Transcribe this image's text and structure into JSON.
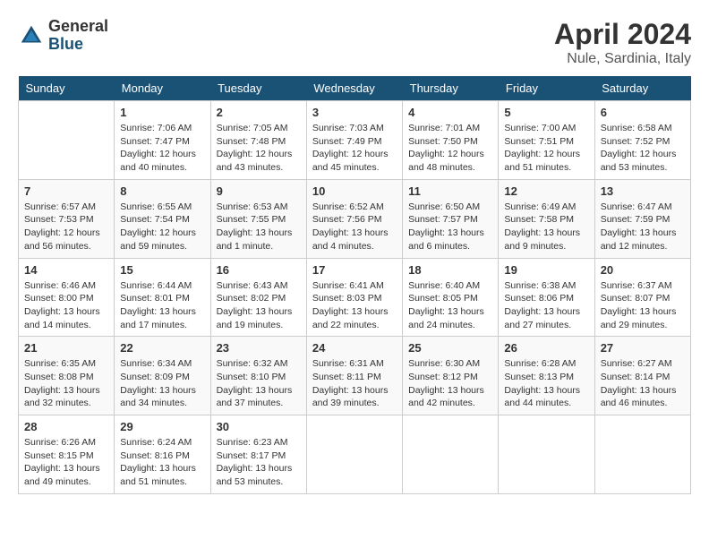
{
  "header": {
    "logo_general": "General",
    "logo_blue": "Blue",
    "month": "April 2024",
    "location": "Nule, Sardinia, Italy"
  },
  "days_of_week": [
    "Sunday",
    "Monday",
    "Tuesday",
    "Wednesday",
    "Thursday",
    "Friday",
    "Saturday"
  ],
  "weeks": [
    [
      {
        "day": "",
        "info": ""
      },
      {
        "day": "1",
        "info": "Sunrise: 7:06 AM\nSunset: 7:47 PM\nDaylight: 12 hours\nand 40 minutes."
      },
      {
        "day": "2",
        "info": "Sunrise: 7:05 AM\nSunset: 7:48 PM\nDaylight: 12 hours\nand 43 minutes."
      },
      {
        "day": "3",
        "info": "Sunrise: 7:03 AM\nSunset: 7:49 PM\nDaylight: 12 hours\nand 45 minutes."
      },
      {
        "day": "4",
        "info": "Sunrise: 7:01 AM\nSunset: 7:50 PM\nDaylight: 12 hours\nand 48 minutes."
      },
      {
        "day": "5",
        "info": "Sunrise: 7:00 AM\nSunset: 7:51 PM\nDaylight: 12 hours\nand 51 minutes."
      },
      {
        "day": "6",
        "info": "Sunrise: 6:58 AM\nSunset: 7:52 PM\nDaylight: 12 hours\nand 53 minutes."
      }
    ],
    [
      {
        "day": "7",
        "info": "Sunrise: 6:57 AM\nSunset: 7:53 PM\nDaylight: 12 hours\nand 56 minutes."
      },
      {
        "day": "8",
        "info": "Sunrise: 6:55 AM\nSunset: 7:54 PM\nDaylight: 12 hours\nand 59 minutes."
      },
      {
        "day": "9",
        "info": "Sunrise: 6:53 AM\nSunset: 7:55 PM\nDaylight: 13 hours\nand 1 minute."
      },
      {
        "day": "10",
        "info": "Sunrise: 6:52 AM\nSunset: 7:56 PM\nDaylight: 13 hours\nand 4 minutes."
      },
      {
        "day": "11",
        "info": "Sunrise: 6:50 AM\nSunset: 7:57 PM\nDaylight: 13 hours\nand 6 minutes."
      },
      {
        "day": "12",
        "info": "Sunrise: 6:49 AM\nSunset: 7:58 PM\nDaylight: 13 hours\nand 9 minutes."
      },
      {
        "day": "13",
        "info": "Sunrise: 6:47 AM\nSunset: 7:59 PM\nDaylight: 13 hours\nand 12 minutes."
      }
    ],
    [
      {
        "day": "14",
        "info": "Sunrise: 6:46 AM\nSunset: 8:00 PM\nDaylight: 13 hours\nand 14 minutes."
      },
      {
        "day": "15",
        "info": "Sunrise: 6:44 AM\nSunset: 8:01 PM\nDaylight: 13 hours\nand 17 minutes."
      },
      {
        "day": "16",
        "info": "Sunrise: 6:43 AM\nSunset: 8:02 PM\nDaylight: 13 hours\nand 19 minutes."
      },
      {
        "day": "17",
        "info": "Sunrise: 6:41 AM\nSunset: 8:03 PM\nDaylight: 13 hours\nand 22 minutes."
      },
      {
        "day": "18",
        "info": "Sunrise: 6:40 AM\nSunset: 8:05 PM\nDaylight: 13 hours\nand 24 minutes."
      },
      {
        "day": "19",
        "info": "Sunrise: 6:38 AM\nSunset: 8:06 PM\nDaylight: 13 hours\nand 27 minutes."
      },
      {
        "day": "20",
        "info": "Sunrise: 6:37 AM\nSunset: 8:07 PM\nDaylight: 13 hours\nand 29 minutes."
      }
    ],
    [
      {
        "day": "21",
        "info": "Sunrise: 6:35 AM\nSunset: 8:08 PM\nDaylight: 13 hours\nand 32 minutes."
      },
      {
        "day": "22",
        "info": "Sunrise: 6:34 AM\nSunset: 8:09 PM\nDaylight: 13 hours\nand 34 minutes."
      },
      {
        "day": "23",
        "info": "Sunrise: 6:32 AM\nSunset: 8:10 PM\nDaylight: 13 hours\nand 37 minutes."
      },
      {
        "day": "24",
        "info": "Sunrise: 6:31 AM\nSunset: 8:11 PM\nDaylight: 13 hours\nand 39 minutes."
      },
      {
        "day": "25",
        "info": "Sunrise: 6:30 AM\nSunset: 8:12 PM\nDaylight: 13 hours\nand 42 minutes."
      },
      {
        "day": "26",
        "info": "Sunrise: 6:28 AM\nSunset: 8:13 PM\nDaylight: 13 hours\nand 44 minutes."
      },
      {
        "day": "27",
        "info": "Sunrise: 6:27 AM\nSunset: 8:14 PM\nDaylight: 13 hours\nand 46 minutes."
      }
    ],
    [
      {
        "day": "28",
        "info": "Sunrise: 6:26 AM\nSunset: 8:15 PM\nDaylight: 13 hours\nand 49 minutes."
      },
      {
        "day": "29",
        "info": "Sunrise: 6:24 AM\nSunset: 8:16 PM\nDaylight: 13 hours\nand 51 minutes."
      },
      {
        "day": "30",
        "info": "Sunrise: 6:23 AM\nSunset: 8:17 PM\nDaylight: 13 hours\nand 53 minutes."
      },
      {
        "day": "",
        "info": ""
      },
      {
        "day": "",
        "info": ""
      },
      {
        "day": "",
        "info": ""
      },
      {
        "day": "",
        "info": ""
      }
    ]
  ]
}
